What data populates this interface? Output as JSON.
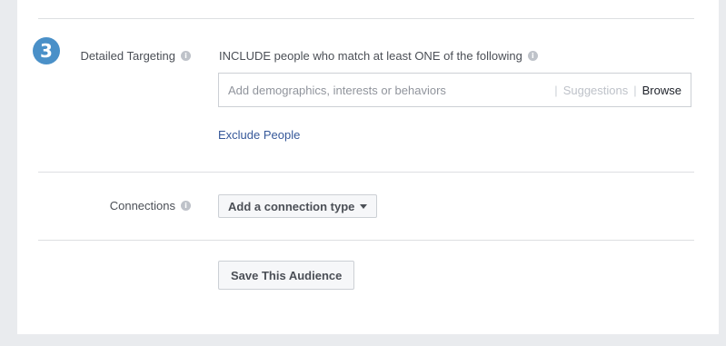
{
  "step": {
    "number": "3",
    "color": "#4a90c8"
  },
  "detailed_targeting": {
    "label": "Detailed Targeting",
    "info_icon": "info-icon",
    "include_text": "INCLUDE people who match at least ONE of the following",
    "search": {
      "placeholder": "Add demographics, interests or behaviors",
      "value": "",
      "suggestions_label": "Suggestions",
      "browse_label": "Browse"
    },
    "exclude_link": "Exclude People"
  },
  "connections": {
    "label": "Connections",
    "info_icon": "info-icon",
    "dropdown_label": "Add a connection type",
    "dropdown_icon": "caret-down-icon"
  },
  "save_button": "Save This Audience",
  "colors": {
    "link": "#365899",
    "page_bg": "#e9ebee"
  }
}
